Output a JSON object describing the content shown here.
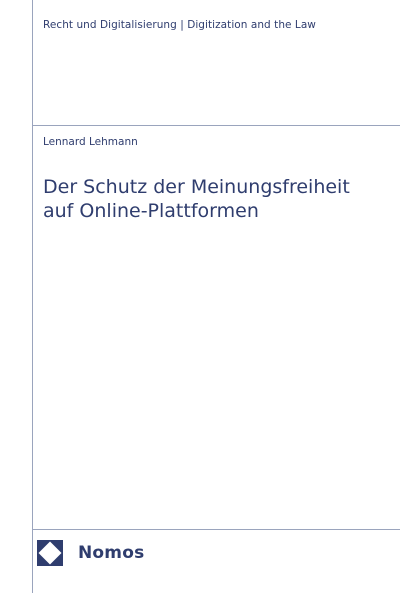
{
  "cover": {
    "series": "Recht und Digitalisierung | Digitization and the Law",
    "author": "Lennard Lehmann",
    "title_lines": [
      "Der Schutz der Meinungsfreiheit",
      "auf Online-Plattformen"
    ],
    "publisher": "Nomos"
  },
  "colors": {
    "text": "#2f3d6e",
    "rule": "#9aa4bd",
    "logo": "#2f3d6e"
  },
  "icons": {
    "publisher_logo": "nomos-logo-icon"
  }
}
